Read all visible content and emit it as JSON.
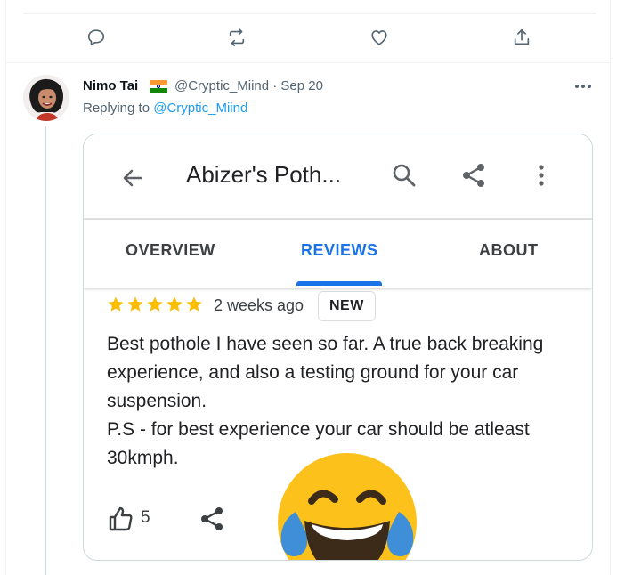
{
  "tweet_actions": [
    "reply-icon",
    "retweet-icon",
    "like-icon",
    "share-icon"
  ],
  "reply_tweet": {
    "display_name": "Nimo Tai",
    "handle_and_date": "@Cryptic_Miind · Sep 20",
    "replying_prefix": "Replying to ",
    "replying_to": "@Cryptic_Miind"
  },
  "embedded_screenshot": {
    "title": "Abizer's Poth...",
    "tabs": [
      {
        "label": "OVERVIEW",
        "active": false
      },
      {
        "label": "REVIEWS",
        "active": true
      },
      {
        "label": "ABOUT",
        "active": false
      }
    ],
    "rating_stars": 5,
    "time_ago": "2 weeks ago",
    "badge": "NEW",
    "review_lines": [
      "Best pothole I have seen so far. A true back breaking experience, and also a testing ground for your car suspension.",
      "P.S - for best experience your car should be atleast 30kmph."
    ],
    "likes": "5"
  },
  "colors": {
    "link": "#1d9bf0",
    "tab_active": "#1a73e8",
    "star": "#fbbc04",
    "muted": "#536471"
  }
}
